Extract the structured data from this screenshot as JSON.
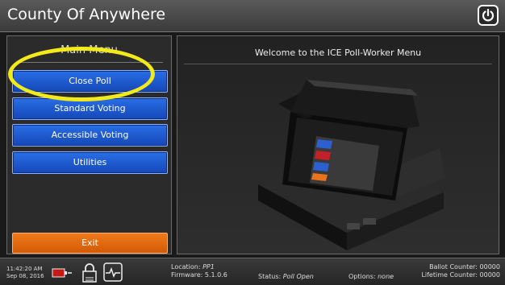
{
  "header": {
    "title": "County Of Anywhere",
    "power_icon": "power-icon"
  },
  "left_panel": {
    "title": "Main Menu",
    "buttons": [
      "Close Poll",
      "Standard Voting",
      "Accessible Voting",
      "Utilities"
    ],
    "exit": "Exit",
    "highlight_color": "#f2ea19"
  },
  "right_panel": {
    "welcome": "Welcome to the ICE Poll-Worker Menu"
  },
  "status_bar": {
    "time": "11:42:20 AM",
    "date": "Sep 08, 2016",
    "location_label": "Location:",
    "location_value": "PP1",
    "firmware_label": "Firmware:",
    "firmware_value": "5.1.0.6",
    "status_label": "Status:",
    "status_value": "Poll Open",
    "options_label": "Options:",
    "options_value": "none",
    "ballot_counter": "Ballot Counter: 00000",
    "lifetime_counter": "Lifetime Counter: 00000"
  },
  "colors": {
    "primary_button": "#1e5fd6",
    "exit_button": "#e86b0c"
  }
}
